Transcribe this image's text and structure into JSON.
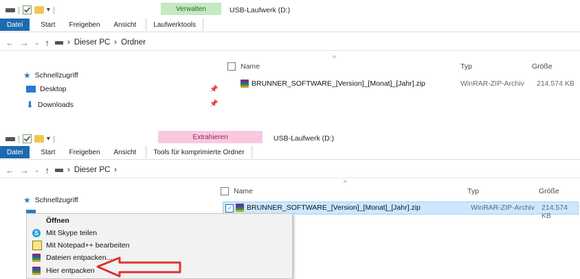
{
  "panel1": {
    "ribbon": {
      "file_tab": "Datei",
      "tabs": [
        "Start",
        "Freigeben",
        "Ansicht"
      ],
      "context_header": "Verwalten",
      "context_tab": "Laufwerktools",
      "context_color": "#c5e9c0",
      "window_title": "USB-Laufwerk (D:)"
    },
    "address": {
      "segments": [
        "Dieser PC",
        "Ordner"
      ]
    },
    "columns": {
      "name": "Name",
      "type": "Typ",
      "size": "Größe"
    },
    "nav": [
      {
        "label": "Schnellzugriff",
        "icon": "star-icon"
      },
      {
        "label": "Desktop",
        "icon": "desktop-icon"
      },
      {
        "label": "Downloads",
        "icon": "download-icon"
      }
    ],
    "file": {
      "name": "BRUNNER_SOFTWARE_[Version]_[Monat]_[Jahr].zip",
      "type": "WinRAR-ZIP-Archiv",
      "size": "214.574 KB"
    }
  },
  "panel2": {
    "ribbon": {
      "file_tab": "Datei",
      "tabs": [
        "Start",
        "Freigeben",
        "Ansicht"
      ],
      "context_header": "Extrahieren",
      "context_tab": "Tools für komprimierte Ordner",
      "context_color": "#f9c8e0",
      "window_title": "USB-Laufwerk (D:)"
    },
    "address": {
      "segments": [
        "Dieser PC"
      ]
    },
    "columns": {
      "name": "Name",
      "type": "Typ",
      "size": "Größe"
    },
    "nav": [
      {
        "label": "Schnellzugriff",
        "icon": "star-icon"
      }
    ],
    "file": {
      "name": "BRUNNER_SOFTWARE_[Version]_[Monat]_[Jahr].zip",
      "type": "WinRAR-ZIP-Archiv",
      "size": "214.574 KB"
    },
    "context_menu": {
      "items": [
        {
          "label": "Öffnen",
          "icon": "",
          "bold": true
        },
        {
          "label": "Mit Skype teilen",
          "icon": "skype-icon"
        },
        {
          "label": "Mit Notepad++ bearbeiten",
          "icon": "notepad-icon"
        },
        {
          "label": "Dateien entpacken...",
          "icon": "winrar-icon"
        },
        {
          "label": "Hier entpacken",
          "icon": "winrar-icon"
        }
      ]
    },
    "annotation": {
      "arrow_color": "#e03030"
    }
  }
}
